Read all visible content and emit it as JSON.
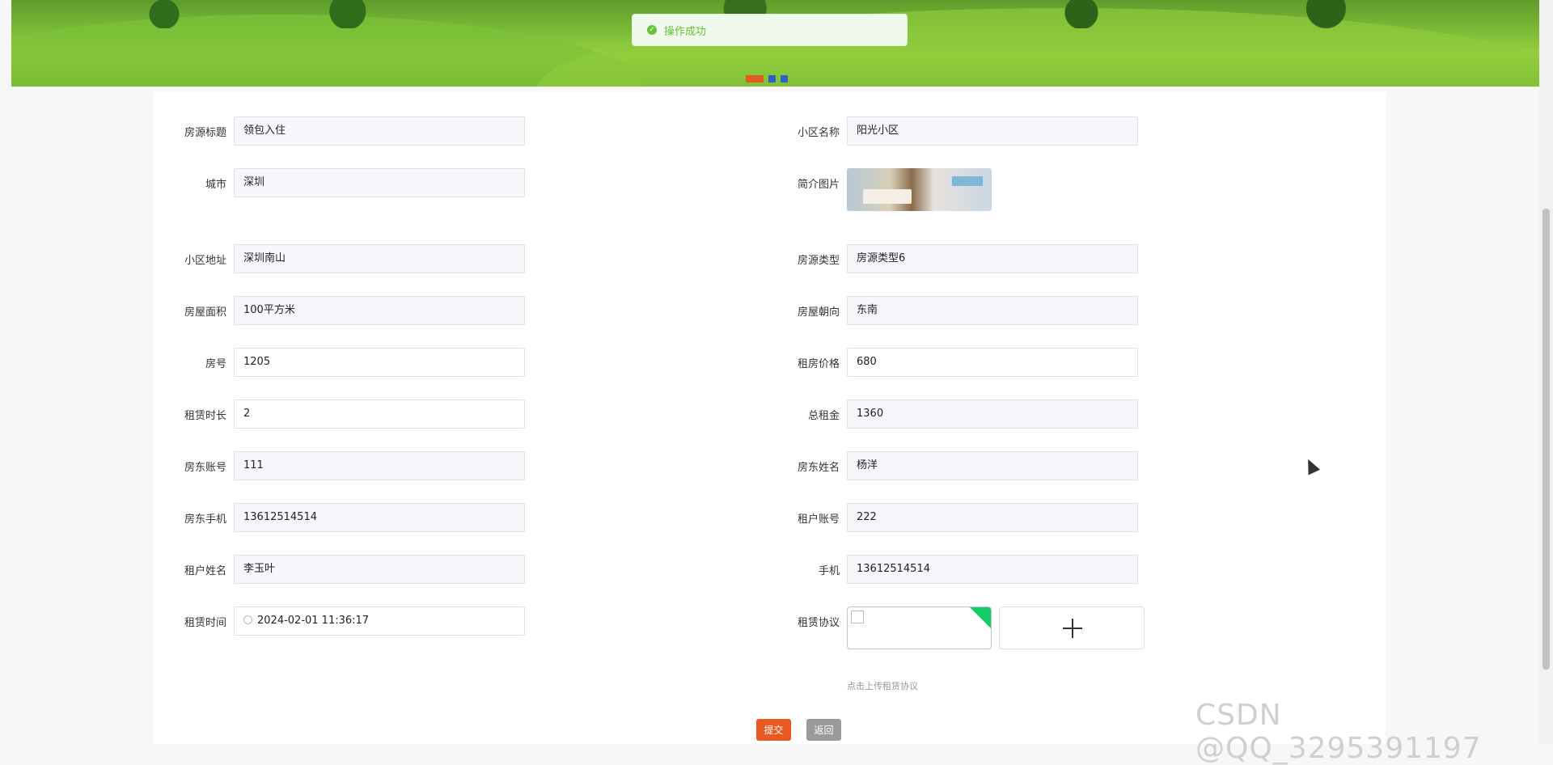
{
  "toast": {
    "message": "操作成功"
  },
  "form": {
    "left": [
      {
        "label": "房源标题",
        "value": "领包入住",
        "editable": false
      },
      {
        "label": "城市",
        "value": "深圳",
        "editable": false
      },
      {
        "label": "小区地址",
        "value": "深圳南山",
        "editable": false
      },
      {
        "label": "房屋面积",
        "value": "100平方米",
        "editable": false
      },
      {
        "label": "房号",
        "value": "1205",
        "editable": true
      },
      {
        "label": "租赁时长",
        "value": "2",
        "editable": true
      },
      {
        "label": "房东账号",
        "value": "111",
        "editable": false
      },
      {
        "label": "房东手机",
        "value": "13612514514",
        "editable": false
      },
      {
        "label": "租户姓名",
        "value": "李玉叶",
        "editable": false
      },
      {
        "label": "租赁时间",
        "value": "2024-02-01 11:36:17",
        "editable": true
      }
    ],
    "right": [
      {
        "label": "小区名称",
        "value": "阳光小区",
        "editable": false
      },
      {
        "label": "简介图片",
        "value": ""
      },
      {
        "label": "房源类型",
        "value": "房源类型6",
        "editable": false
      },
      {
        "label": "房屋朝向",
        "value": "东南",
        "editable": false
      },
      {
        "label": "租房价格",
        "value": "680",
        "editable": true
      },
      {
        "label": "总租金",
        "value": "1360",
        "editable": false
      },
      {
        "label": "房东姓名",
        "value": "杨洋",
        "editable": false
      },
      {
        "label": "租户账号",
        "value": "222",
        "editable": false
      },
      {
        "label": "手机",
        "value": "13612514514",
        "editable": false
      },
      {
        "label": "租赁协议",
        "value": ""
      }
    ],
    "upload_hint": "点击上传租赁协议"
  },
  "buttons": {
    "submit": "提交",
    "back": "返回"
  },
  "watermark": "CSDN @QQ_3295391197",
  "colors": {
    "success": "#67c23a",
    "submit": "#e8591f",
    "back": "#9a9a9a",
    "carousel_active": "#e05a22",
    "carousel_dot": "#2d63c7"
  }
}
